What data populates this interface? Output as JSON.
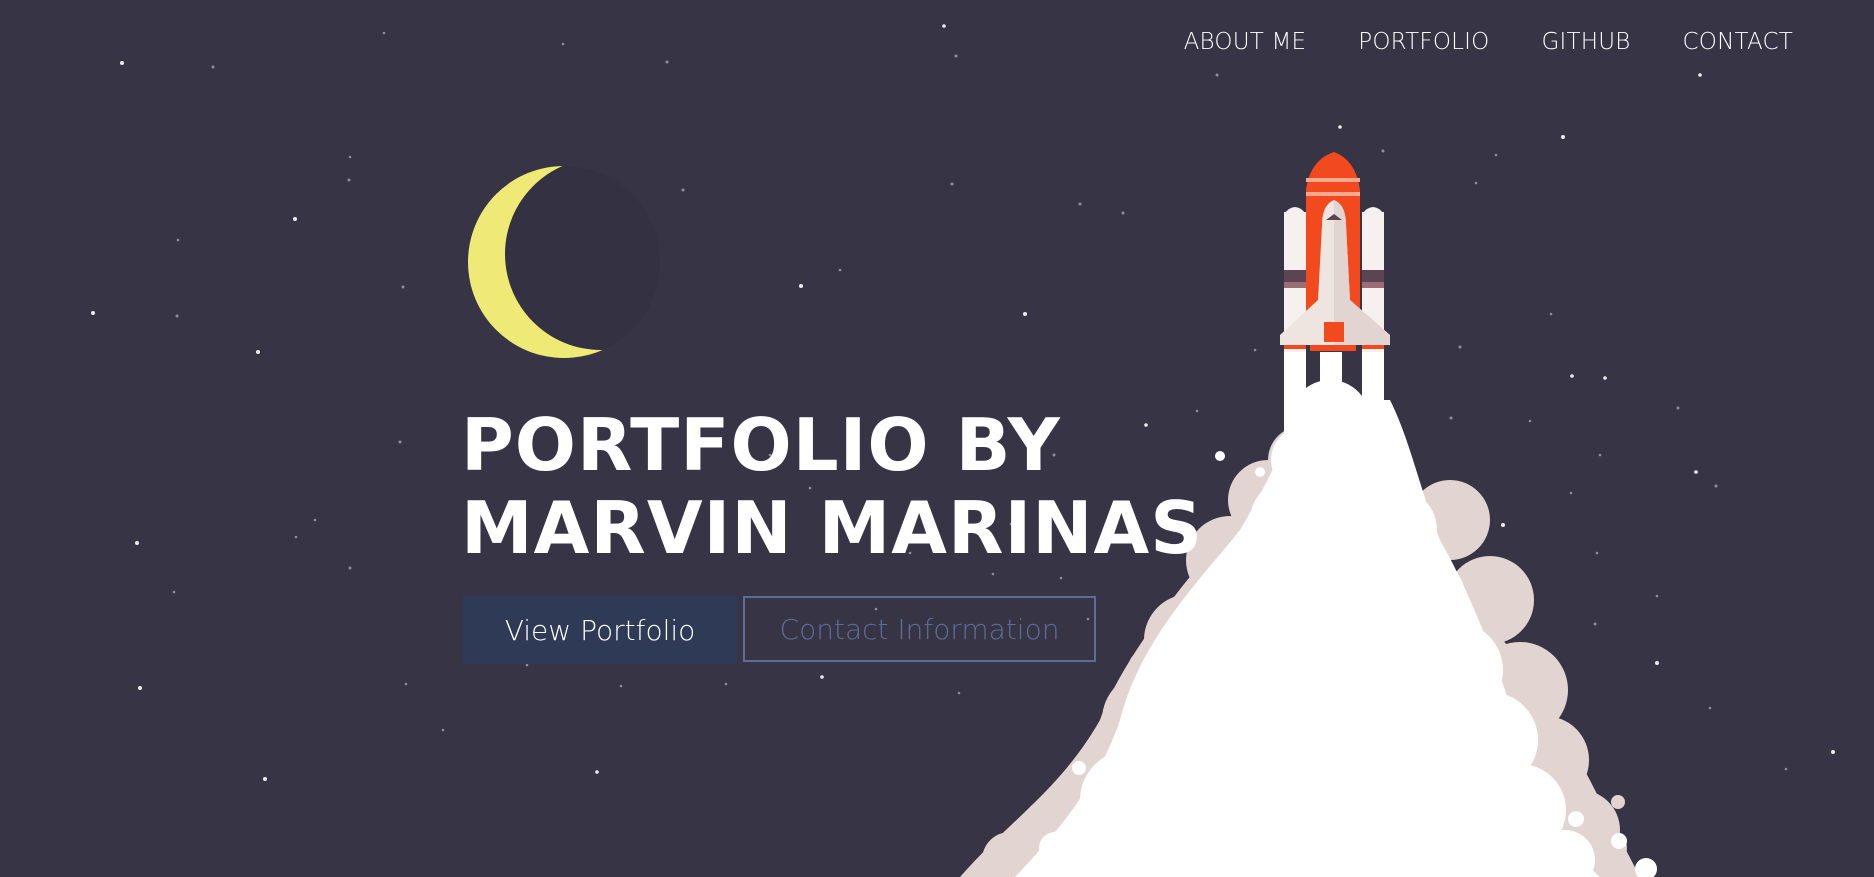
{
  "nav": {
    "items": [
      {
        "label": "ABOUT ME"
      },
      {
        "label": "PORTFOLIO"
      },
      {
        "label": "GITHUB"
      },
      {
        "label": "CONTACT"
      }
    ]
  },
  "hero": {
    "title_line1": "PORTFOLIO BY",
    "title_line2": "MARVIN MARINAS",
    "primary_button": "View Portfolio",
    "secondary_button": "Contact Information"
  },
  "icons": {
    "moon": "crescent-moon-icon",
    "rocket": "space-shuttle-illustration",
    "stars": "star-field"
  },
  "colors": {
    "background": "#363445",
    "moon": "#F8F47A",
    "primary_button": "#2E3A56",
    "secondary_border": "#5F6D96",
    "rocket_red": "#F24A1E",
    "smoke": "#FFFFFF",
    "smoke_shadow": "#E2D4D1"
  }
}
